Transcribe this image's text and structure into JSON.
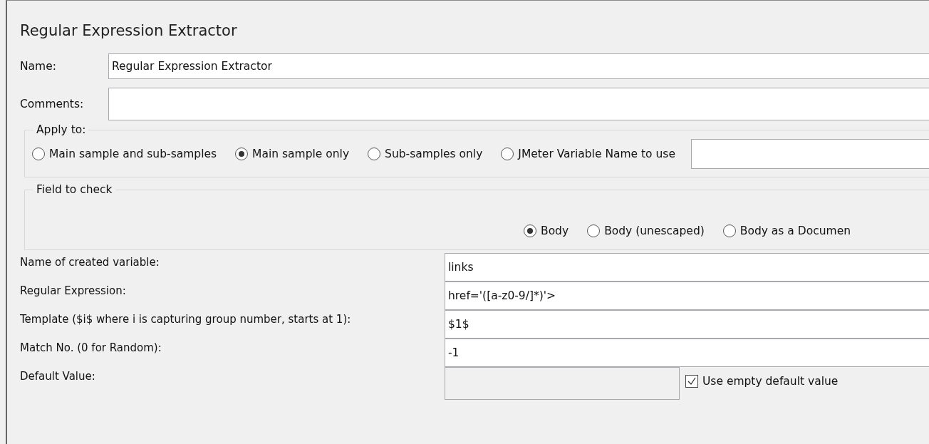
{
  "title": "Regular Expression Extractor",
  "name": {
    "label": "Name:",
    "value": "Regular Expression Extractor"
  },
  "comments": {
    "label": "Comments:"
  },
  "apply_to": {
    "legend": "Apply to:",
    "options": [
      {
        "label": "Main sample and sub-samples",
        "selected": false
      },
      {
        "label": "Main sample only",
        "selected": true
      },
      {
        "label": "Sub-samples only",
        "selected": false
      },
      {
        "label": "JMeter Variable Name to use",
        "selected": false
      }
    ]
  },
  "field_to_check": {
    "legend": "Field to check",
    "options": [
      {
        "label": "Body",
        "selected": true
      },
      {
        "label": "Body (unescaped)",
        "selected": false
      },
      {
        "label": "Body as a Documen",
        "selected": false
      }
    ]
  },
  "settings": [
    {
      "label": "Name of created variable:",
      "value": "links",
      "disabled": false
    },
    {
      "label": "Regular Expression:",
      "value": "href='([a-z0-9/]*)'>",
      "disabled": false
    },
    {
      "label": "Template ($i$ where i is capturing group number, starts at 1):",
      "value": "$1$",
      "disabled": false
    },
    {
      "label": "Match No. (0 for Random):",
      "value": "-1",
      "disabled": false
    },
    {
      "label": "Default Value:",
      "disabled": true
    }
  ],
  "use_empty_default": {
    "label": "Use empty default value",
    "checked": true
  }
}
